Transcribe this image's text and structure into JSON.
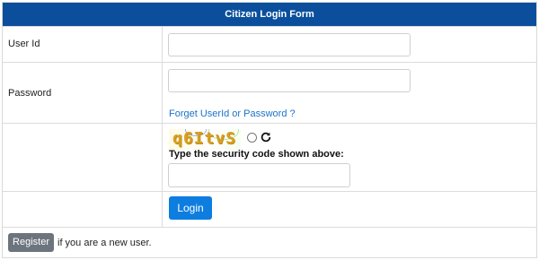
{
  "form": {
    "title": "Citizen Login Form",
    "userid_label": "User Id",
    "userid_value": "",
    "password_label": "Password",
    "password_value": "",
    "forget_link": "Forget UserId or Password ?",
    "captcha_text": "q6ItvS",
    "security_label": "Type the security code shown above:",
    "security_value": "",
    "login_label": "Login",
    "register_label": "Register",
    "register_note": "if you are a new user."
  },
  "colors": {
    "header_bg": "#0b4f9c",
    "login_bg": "#0d7ddf",
    "register_bg": "#6c757d",
    "link": "#1a73c8"
  },
  "icons": {
    "captcha_refresh": "refresh-icon",
    "captcha_audio_toggle": "radio-icon"
  }
}
